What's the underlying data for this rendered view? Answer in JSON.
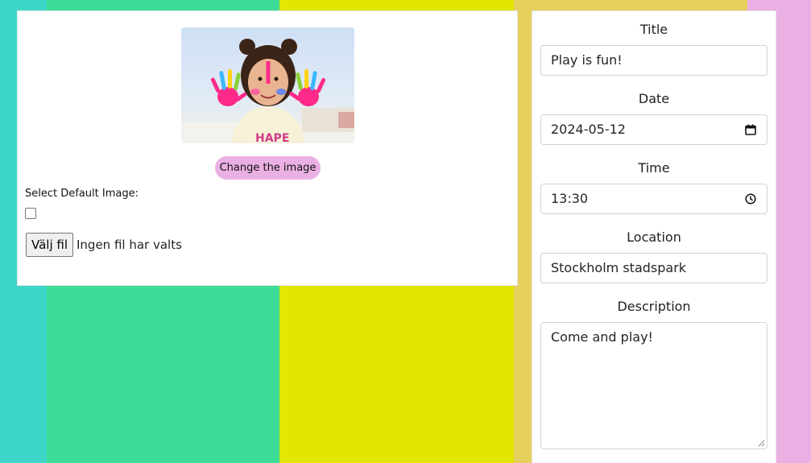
{
  "image_panel": {
    "change_button": "Change the image",
    "default_image_label": "Select Default Image:",
    "default_image_checked": false,
    "file_button": "Välj fil",
    "file_status": "Ingen fil har valts"
  },
  "form": {
    "title_label": "Title",
    "title_value": "Play is fun!",
    "date_label": "Date",
    "date_value": "2024-05-12",
    "time_label": "Time",
    "time_value": "13:30",
    "location_label": "Location",
    "location_value": "Stockholm stadspark",
    "description_label": "Description",
    "description_value": "Come and play!"
  },
  "icons": {
    "date": "calendar-icon",
    "time": "clock-icon"
  },
  "colors": {
    "stripe_teal": "#3dd6c9",
    "stripe_green": "#3ddc97",
    "stripe_yellow": "#e3e600",
    "stripe_gold": "#e6cf5c",
    "stripe_pink": "#ebb0e3",
    "button_pink": "#ebb0e3"
  }
}
